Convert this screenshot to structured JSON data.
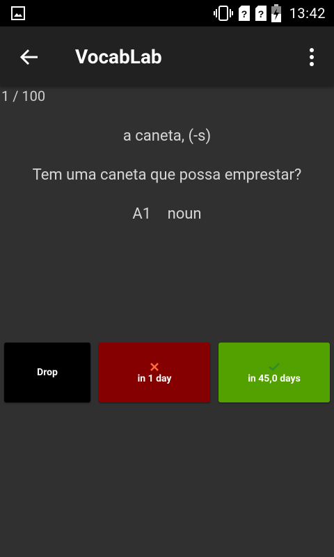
{
  "status_bar": {
    "time": "13:42",
    "icons": [
      "image-icon",
      "vibrate-icon",
      "sim-unknown-icon",
      "sim-unknown-icon",
      "battery-charging-icon"
    ]
  },
  "app_bar": {
    "title": "VocabLab",
    "back_icon": "arrow-back-icon",
    "menu_icon": "more-vert-icon"
  },
  "progress": {
    "counter": "1 / 100"
  },
  "card": {
    "word": "a caneta, (-s)",
    "example": "Tem uma caneta que possa emprestar?",
    "level": "A1",
    "part_of_speech": "noun"
  },
  "actions": {
    "drop_label": "Drop",
    "again_label": "in 1 day",
    "good_label": "in 45,0 days",
    "colors": {
      "drop": "#000000",
      "again": "#850000",
      "good": "#53a100",
      "again_mark": "#ff6a3d",
      "good_mark": "#2e8a2e"
    }
  }
}
